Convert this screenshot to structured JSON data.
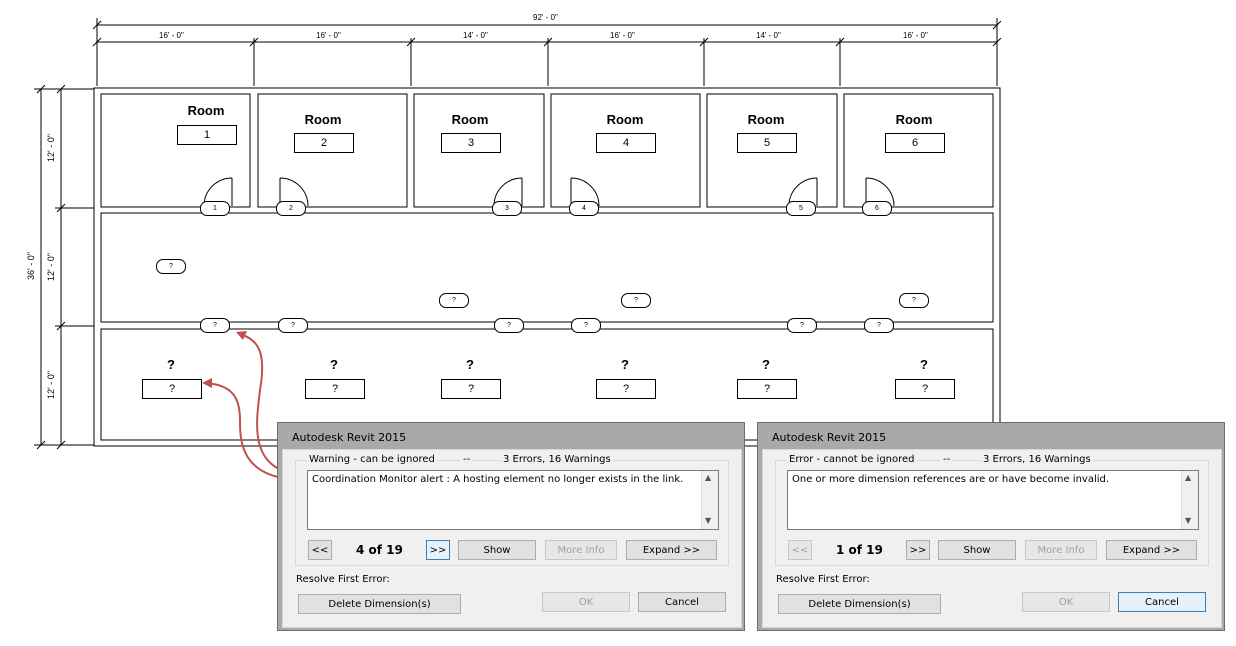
{
  "plan": {
    "overall_dimension": "92' - 0\"",
    "segment_dimensions": [
      "16' - 0\"",
      "16' - 0\"",
      "14' - 0\"",
      "16' - 0\"",
      "14' - 0\"",
      "16' - 0\""
    ],
    "overall_vertical_dimension": "36' - 0\"",
    "vertical_dimensions": [
      "12' - 0\"",
      "12' - 0\"",
      "12' - 0\""
    ],
    "top_room_label": "Room",
    "top_room_numbers": [
      "1",
      "2",
      "3",
      "4",
      "5",
      "6"
    ],
    "door_tags_top": [
      "1",
      "2",
      "3",
      "4",
      "5",
      "6"
    ],
    "unknown_tag": "?",
    "bottom_room_label": "?",
    "bottom_room_number": "?"
  },
  "dialogs": [
    {
      "title": "Autodesk Revit 2015",
      "severity": "Warning - can be ignored",
      "separator": "--",
      "summary": "3 Errors, 16 Warnings",
      "message": "Coordination Monitor alert : A hosting element no longer exists in the link.",
      "prev_label": "<<",
      "counter": "4 of 19",
      "next_label": ">>",
      "show_label": "Show",
      "more_info_label": "More Info",
      "expand_label": "Expand >>",
      "resolve_label": "Resolve First Error:",
      "delete_label": "Delete Dimension(s)",
      "ok_label": "OK",
      "cancel_label": "Cancel"
    },
    {
      "title": "Autodesk Revit 2015",
      "severity": "Error - cannot be ignored",
      "separator": "--",
      "summary": "3 Errors, 16 Warnings",
      "message": "One or more dimension references are or have become invalid.",
      "prev_label": "<<",
      "counter": "1 of 19",
      "next_label": ">>",
      "show_label": "Show",
      "more_info_label": "More Info",
      "expand_label": "Expand >>",
      "resolve_label": "Resolve First Error:",
      "delete_label": "Delete Dimension(s)",
      "ok_label": "OK",
      "cancel_label": "Cancel"
    }
  ],
  "colors": {
    "annotation_arrow": "#c0504d",
    "dialog_frame": "#a9a9a9"
  }
}
